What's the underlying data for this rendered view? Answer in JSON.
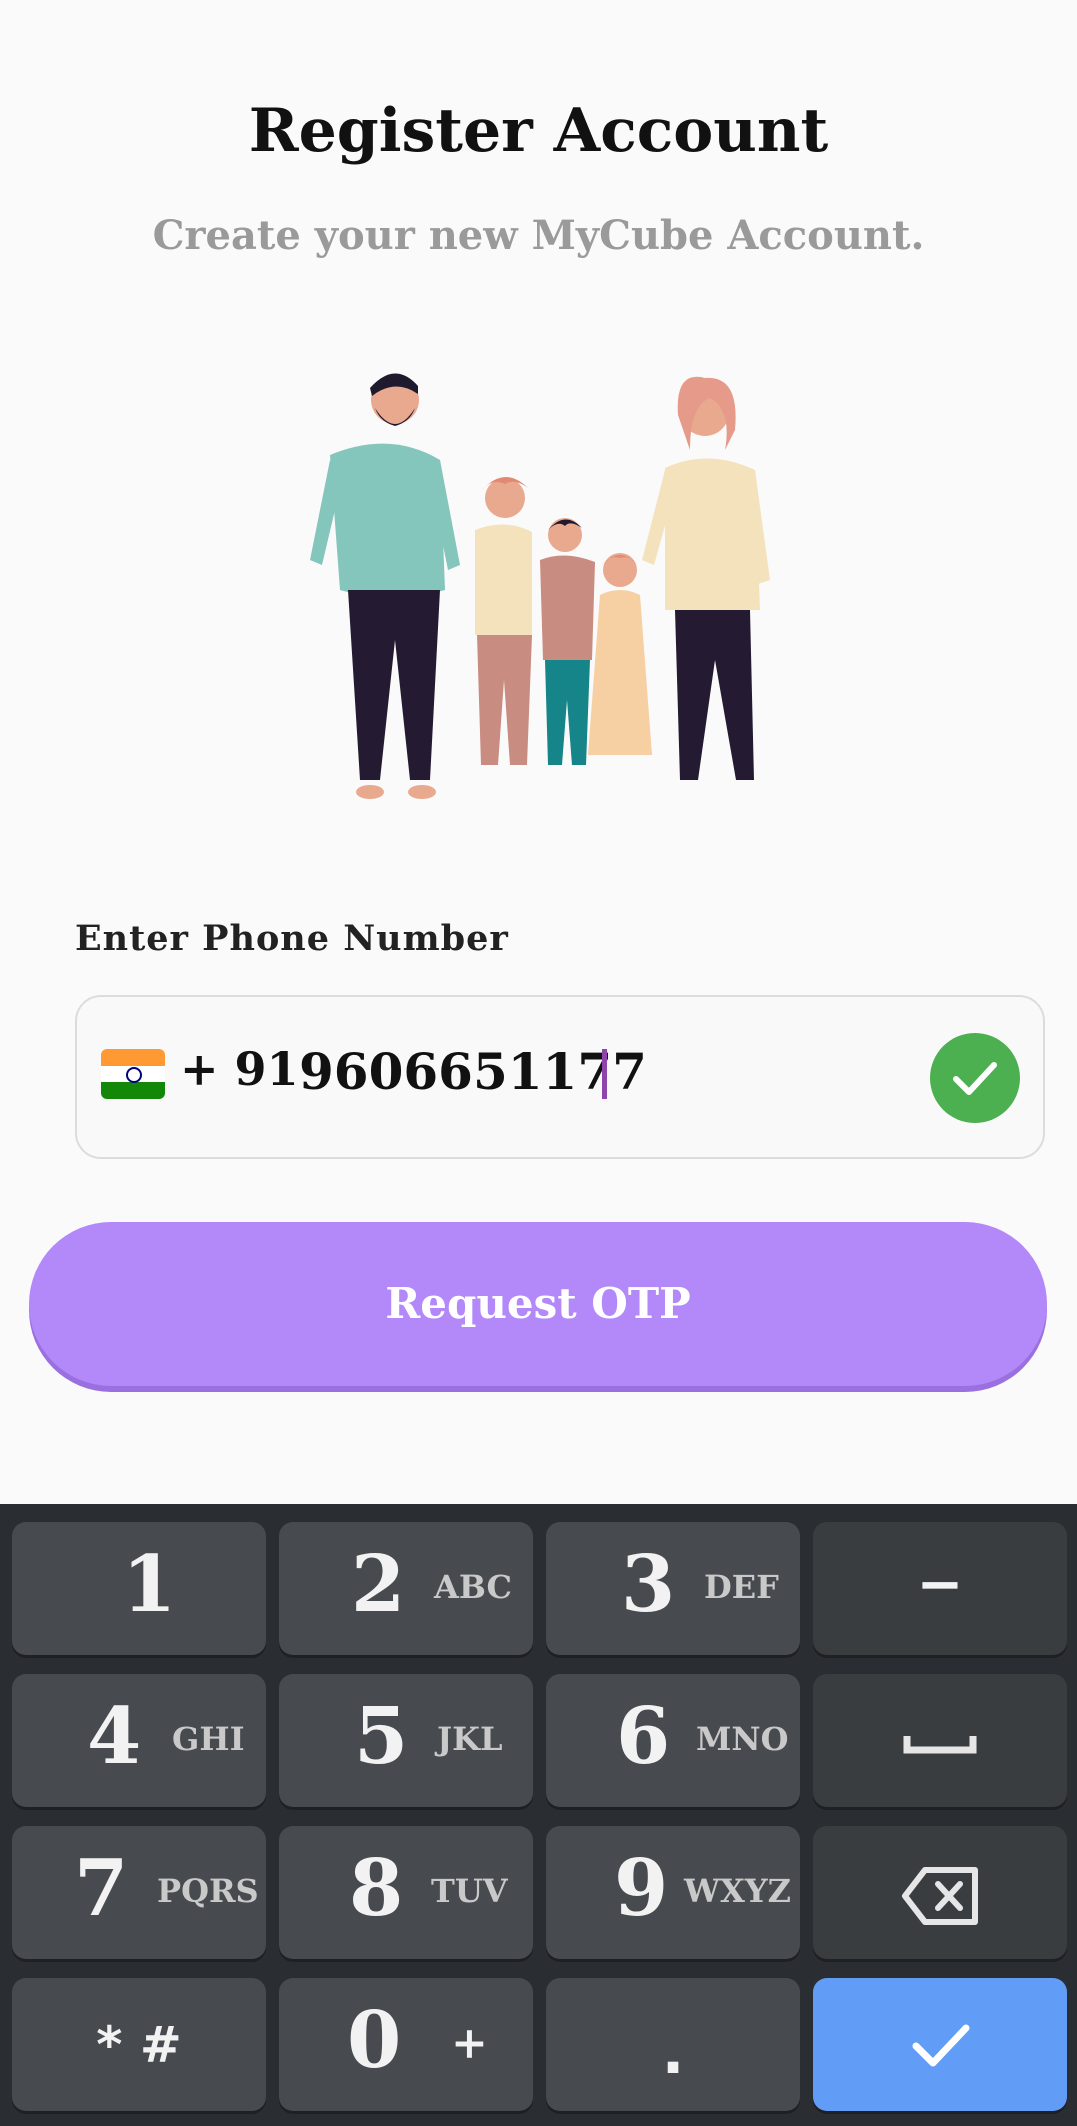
{
  "header": {
    "title": "Register Account",
    "subtitle": "Create your new MyCube Account."
  },
  "form": {
    "phone_label": "Enter Phone Number",
    "country_code": "+ 91",
    "phone_number": "9606651177",
    "country_flag": "india-flag-icon",
    "valid_color": "#4caf50"
  },
  "actions": {
    "request_otp_label": "Request OTP",
    "button_color": "#b388f9"
  },
  "keyboard": {
    "keys": [
      {
        "digit": "1",
        "letters": ""
      },
      {
        "digit": "2",
        "letters": "ABC"
      },
      {
        "digit": "3",
        "letters": "DEF"
      },
      {
        "symbol": "−"
      },
      {
        "digit": "4",
        "letters": "GHI"
      },
      {
        "digit": "5",
        "letters": "JKL"
      },
      {
        "digit": "6",
        "letters": "MNO"
      },
      {
        "symbol": "space"
      },
      {
        "digit": "7",
        "letters": "PQRS"
      },
      {
        "digit": "8",
        "letters": "TUV"
      },
      {
        "digit": "9",
        "letters": "WXYZ"
      },
      {
        "symbol": "backspace"
      },
      {
        "symbol": "* #"
      },
      {
        "digit": "0",
        "letters": "+"
      },
      {
        "symbol": "."
      },
      {
        "symbol": "done"
      }
    ],
    "done_color": "#619cf6"
  }
}
